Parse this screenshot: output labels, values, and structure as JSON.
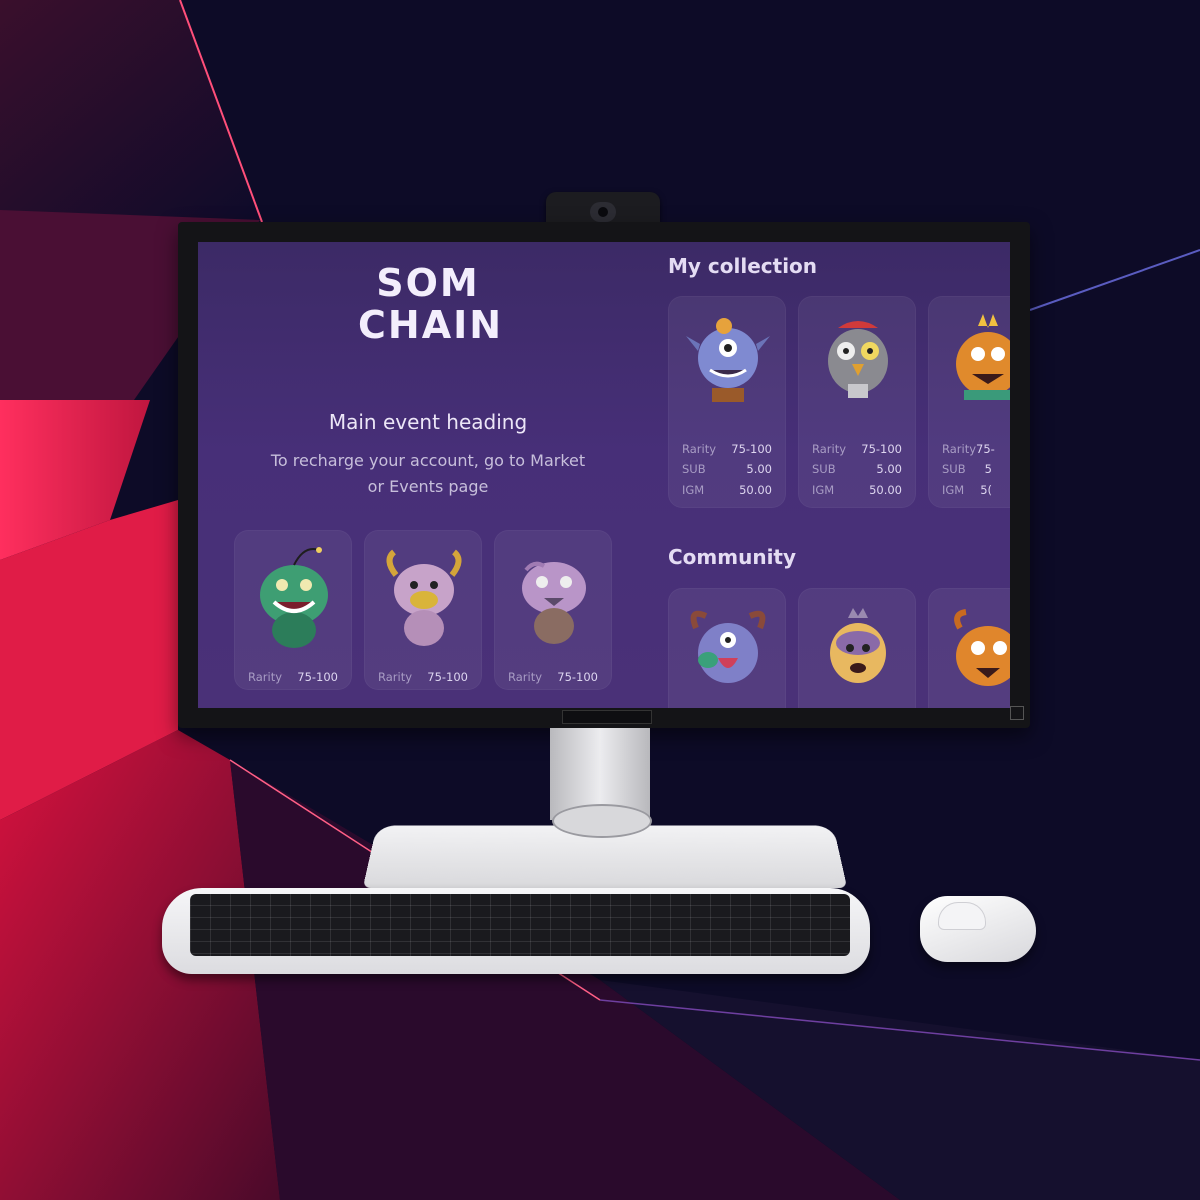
{
  "brand": {
    "line1": "SOM",
    "line2": "CHAIN"
  },
  "event": {
    "heading": "Main event heading",
    "subtext": "To recharge your account, go to Market or Events page"
  },
  "event_cards": [
    {
      "rarity_label": "Rarity",
      "rarity_value": "75-100"
    },
    {
      "rarity_label": "Rarity",
      "rarity_value": "75-100"
    },
    {
      "rarity_label": "Rarity",
      "rarity_value": "75-100"
    }
  ],
  "collection": {
    "title": "My collection",
    "cards": [
      {
        "rarity_label": "Rarity",
        "rarity_value": "75-100",
        "sub_label": "SUB",
        "sub_value": "5.00",
        "igm_label": "IGM",
        "igm_value": "50.00"
      },
      {
        "rarity_label": "Rarity",
        "rarity_value": "75-100",
        "sub_label": "SUB",
        "sub_value": "5.00",
        "igm_label": "IGM",
        "igm_value": "50.00"
      },
      {
        "rarity_label": "Rarity",
        "rarity_value": "75-",
        "sub_label": "SUB",
        "sub_value": "5",
        "igm_label": "IGM",
        "igm_value": "5("
      }
    ]
  },
  "community": {
    "title": "Community"
  }
}
